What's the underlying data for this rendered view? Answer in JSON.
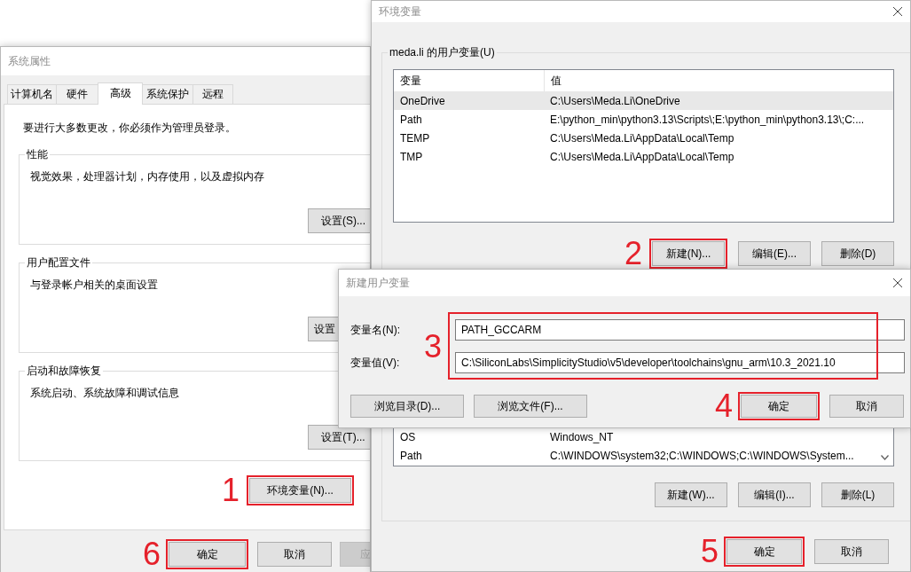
{
  "system_properties": {
    "title": "系统属性",
    "tabs": [
      {
        "label": "计算机名",
        "selected": false
      },
      {
        "label": "硬件",
        "selected": false
      },
      {
        "label": "高级",
        "selected": true
      },
      {
        "label": "系统保护",
        "selected": false
      },
      {
        "label": "远程",
        "selected": false
      }
    ],
    "notice": "要进行大多数更改，你必须作为管理员登录。",
    "groups": [
      {
        "title": "性能",
        "description": "视觉效果，处理器计划，内存使用，以及虚拟内存",
        "button": "设置(S)..."
      },
      {
        "title": "用户配置文件",
        "description": "与登录帐户相关的桌面设置",
        "button": "设置"
      },
      {
        "title": "启动和故障恢复",
        "description": "系统启动、系统故障和调试信息",
        "button": "设置(T)..."
      }
    ],
    "env_button": {
      "label": "环境变量(N)...",
      "step": "1"
    },
    "buttons": [
      {
        "label": "确定",
        "step": "6",
        "disabled": false
      },
      {
        "label": "取消",
        "disabled": false
      },
      {
        "label": "应",
        "disabled": true
      }
    ]
  },
  "environment_variables": {
    "title": "环境变量",
    "user_group": {
      "title": "meda.li 的用户变量(U)",
      "columns": [
        "变量",
        "值"
      ],
      "rows": [
        {
          "name": "OneDrive",
          "value": "C:\\Users\\Meda.Li\\OneDrive",
          "selected": true
        },
        {
          "name": "Path",
          "value": "E:\\python_min\\python3.13\\Scripts\\;E:\\python_min\\python3.13\\;C:...",
          "selected": false
        },
        {
          "name": "TEMP",
          "value": "C:\\Users\\Meda.Li\\AppData\\Local\\Temp",
          "selected": false
        },
        {
          "name": "TMP",
          "value": "C:\\Users\\Meda.Li\\AppData\\Local\\Temp",
          "selected": false
        }
      ],
      "buttons": [
        {
          "label": "新建(N)...",
          "step": "2"
        },
        {
          "label": "编辑(E)..."
        },
        {
          "label": "删除(D)"
        }
      ]
    },
    "system_group": {
      "rows": [
        {
          "name": "OS",
          "value": "Windows_NT",
          "selected": false
        },
        {
          "name": "Path",
          "value": "C:\\WINDOWS\\system32;C:\\WINDOWS;C:\\WINDOWS\\System...",
          "selected": false
        }
      ],
      "buttons": [
        {
          "label": "新建(W)..."
        },
        {
          "label": "编辑(I)..."
        },
        {
          "label": "删除(L)"
        }
      ]
    },
    "buttons": [
      {
        "label": "确定",
        "step": "5"
      },
      {
        "label": "取消"
      }
    ]
  },
  "new_variable_dialog": {
    "title": "新建用户变量",
    "fields": [
      {
        "label": "变量名(N):",
        "value": "PATH_GCCARM"
      },
      {
        "label": "变量值(V):",
        "value": "C:\\SiliconLabs\\SimplicityStudio\\v5\\developer\\toolchains\\gnu_arm\\10.3_2021.10"
      }
    ],
    "fields_step": "3",
    "buttons": [
      {
        "label": "浏览目录(D)..."
      },
      {
        "label": "浏览文件(F)..."
      },
      {
        "label": "确定",
        "step": "4"
      },
      {
        "label": "取消"
      }
    ]
  }
}
